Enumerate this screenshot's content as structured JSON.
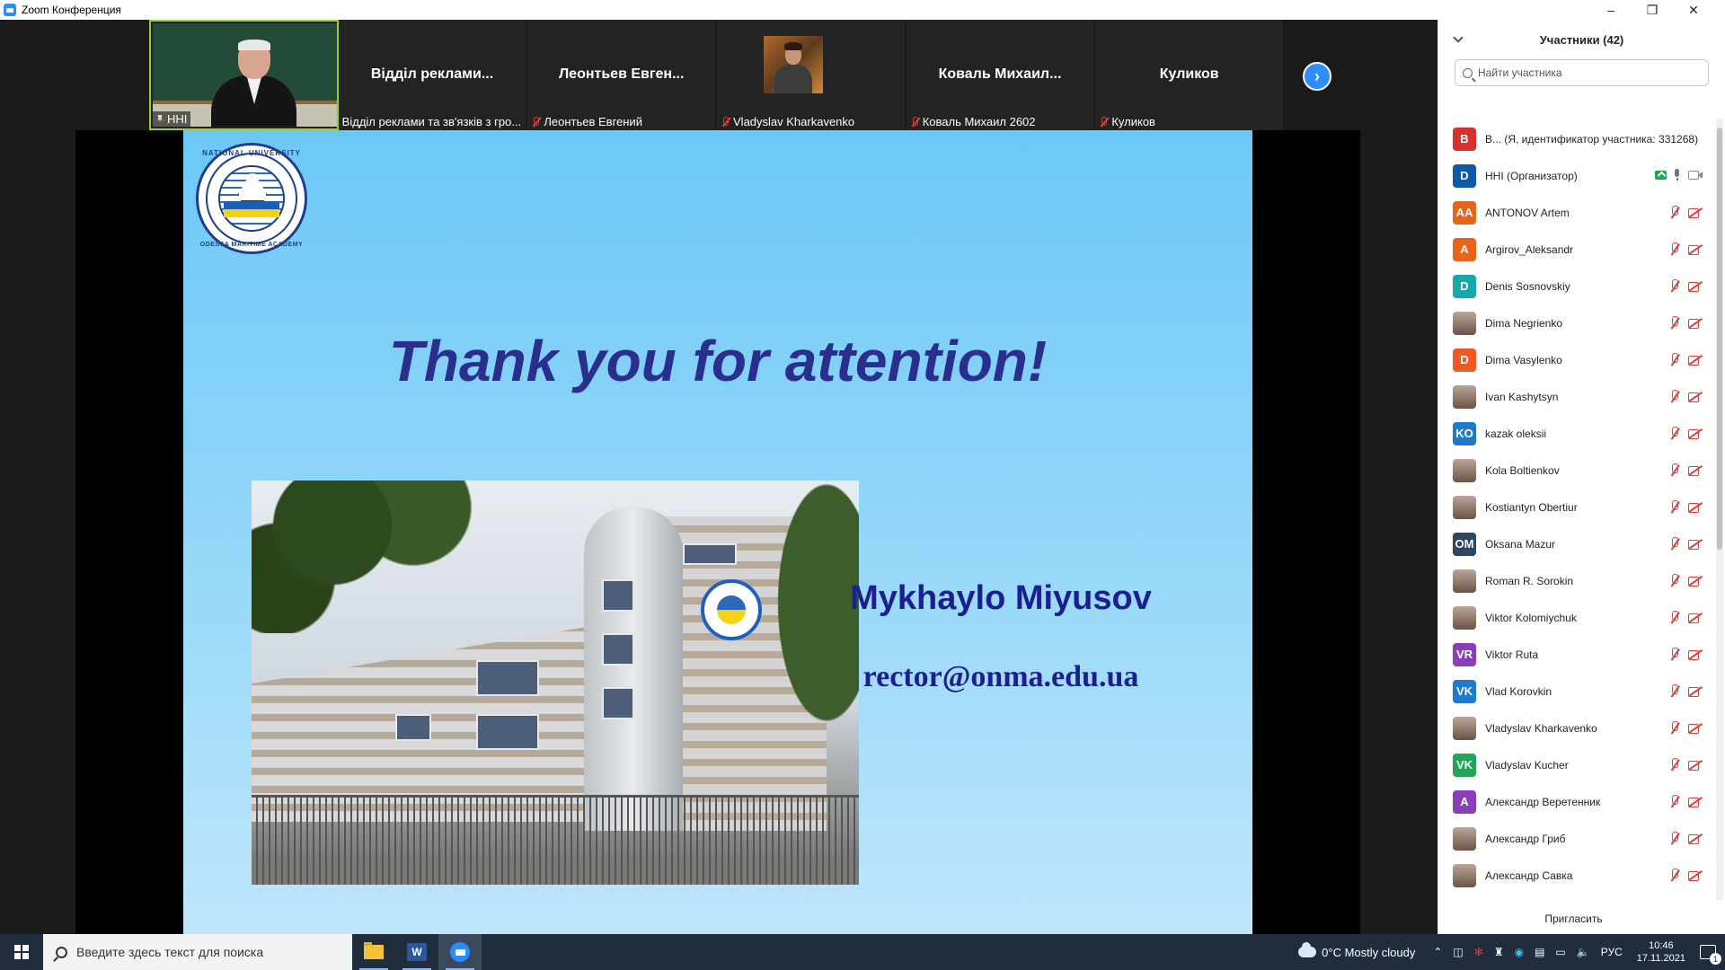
{
  "window": {
    "title": "Zoom Конференция"
  },
  "gallery": {
    "tiles": [
      {
        "label": "ННІ",
        "pinned": true,
        "has_video": true
      },
      {
        "big_name": "Відділ реклами...",
        "label": "Відділ реклами та зв'язків з гро..."
      },
      {
        "big_name": "Леонтьев Евген...",
        "label": "Леонтьев Евгений"
      },
      {
        "label": "Vladyslav Kharkavenko",
        "has_video": true
      },
      {
        "big_name": "Коваль Михаил...",
        "label": "Коваль Михаил 2602"
      },
      {
        "big_name": "Куликов",
        "label": "Куликов"
      }
    ],
    "next_icon": "chevron-right-icon"
  },
  "slide": {
    "logo_top": "NATIONAL UNIVERSITY",
    "logo_bottom": "ODESSA MARITIME ACADEMY",
    "title": "Thank you for attention!",
    "name": "Mykhaylo Miyusov",
    "email": "rector@onma.edu.ua"
  },
  "participants": {
    "header": "Участники (42)",
    "search_placeholder": "Найти участника",
    "invite": "Пригласить",
    "list": [
      {
        "initials": "B",
        "color": "#d9302c",
        "name": "В... (Я, идентификатор участника: 331268)",
        "icons": "none"
      },
      {
        "initials": "D",
        "color": "#0e5aa7",
        "name": "ННІ (Организатор)",
        "icons": "host"
      },
      {
        "initials": "AA",
        "color": "#e8641b",
        "name": "ANTONOV Artem",
        "icons": "muted"
      },
      {
        "initials": "A",
        "color": "#e8641b",
        "name": "Argirov_Aleksandr",
        "icons": "muted"
      },
      {
        "initials": "D",
        "color": "#1aa7a7",
        "name": "Denis Sosnovskiy",
        "icons": "muted"
      },
      {
        "initials": "",
        "color": "photo",
        "name": "Dima Negrienko",
        "icons": "muted"
      },
      {
        "initials": "D",
        "color": "#f05a22",
        "name": "Dima Vasylenko",
        "icons": "muted"
      },
      {
        "initials": "",
        "color": "photo",
        "name": "Ivan Kashytsyn",
        "icons": "muted"
      },
      {
        "initials": "KO",
        "color": "#1f7ac9",
        "name": "kazak oleksii",
        "icons": "muted"
      },
      {
        "initials": "",
        "color": "photo",
        "name": "Kola Boltienkov",
        "icons": "muted"
      },
      {
        "initials": "",
        "color": "photo",
        "name": "Kostiantyn Obertiur",
        "icons": "muted"
      },
      {
        "initials": "OM",
        "color": "#2f4560",
        "name": "Oksana Mazur",
        "icons": "muted"
      },
      {
        "initials": "",
        "color": "photo",
        "name": "Roman R. Sorokin",
        "icons": "muted"
      },
      {
        "initials": "",
        "color": "photo",
        "name": "Viktor Kolomiychuk",
        "icons": "muted"
      },
      {
        "initials": "VR",
        "color": "#8a3fb8",
        "name": "Viktor Ruta",
        "icons": "muted"
      },
      {
        "initials": "VK",
        "color": "#1f7ac9",
        "name": "Vlad Korovkin",
        "icons": "muted"
      },
      {
        "initials": "",
        "color": "photo",
        "name": "Vladyslav Kharkavenko",
        "icons": "muted"
      },
      {
        "initials": "VK",
        "color": "#23a559",
        "name": "Vladyslav Kucher",
        "icons": "muted"
      },
      {
        "initials": "A",
        "color": "#8a3fb8",
        "name": "Александр Веретенник",
        "icons": "muted"
      },
      {
        "initials": "",
        "color": "photo",
        "name": "Александр Гриб",
        "icons": "muted"
      },
      {
        "initials": "",
        "color": "photo",
        "name": "Александр Савка",
        "icons": "muted"
      }
    ]
  },
  "taskbar": {
    "search_placeholder": "Введите здесь текст для поиска",
    "word_letter": "W",
    "weather": "0°C  Mostly cloudy",
    "lang": "РУС",
    "time": "10:46",
    "date": "17.11.2021",
    "notifications": "1"
  }
}
